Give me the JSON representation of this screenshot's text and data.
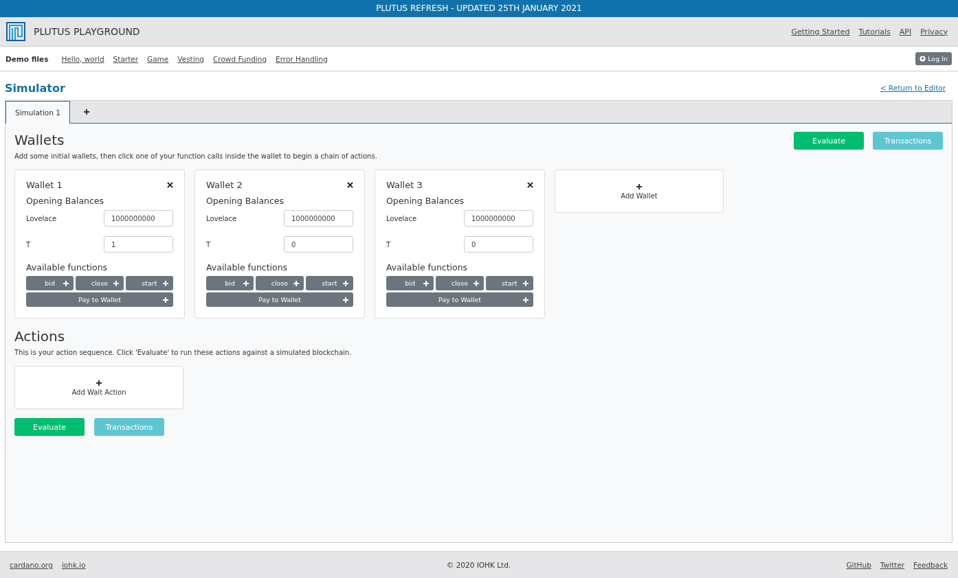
{
  "banner": "PLUTUS REFRESH - UPDATED 25TH JANUARY 2021",
  "header": {
    "title": "PLUTUS PLAYGROUND",
    "links": [
      "Getting Started",
      "Tutorials",
      "API",
      "Privacy"
    ]
  },
  "demo_bar": {
    "label": "Demo files",
    "files": [
      "Hello, world",
      "Starter",
      "Game",
      "Vesting",
      "Crowd Funding",
      "Error Handling"
    ],
    "login": "Log In"
  },
  "page": {
    "title": "Simulator",
    "return_link": "< Return to Editor"
  },
  "tabs": [
    {
      "label": "Simulation 1",
      "selected": true
    }
  ],
  "wallets_section": {
    "title": "Wallets",
    "description": "Add some initial wallets, then click one of your function calls inside the wallet to begin a chain of actions.",
    "evaluate": "Evaluate",
    "transactions": "Transactions"
  },
  "wallets": [
    {
      "title": "Wallet 1",
      "balances_title": "Opening Balances",
      "balances": [
        {
          "label": "Lovelace",
          "value": "1000000000"
        },
        {
          "label": "T",
          "value": "1"
        }
      ],
      "functions_title": "Available functions",
      "functions": [
        "bid",
        "close",
        "start",
        "Pay to Wallet"
      ]
    },
    {
      "title": "Wallet 2",
      "balances_title": "Opening Balances",
      "balances": [
        {
          "label": "Lovelace",
          "value": "1000000000"
        },
        {
          "label": "T",
          "value": "0"
        }
      ],
      "functions_title": "Available functions",
      "functions": [
        "bid",
        "close",
        "start",
        "Pay to Wallet"
      ]
    },
    {
      "title": "Wallet 3",
      "balances_title": "Opening Balances",
      "balances": [
        {
          "label": "Lovelace",
          "value": "1000000000"
        },
        {
          "label": "T",
          "value": "0"
        }
      ],
      "functions_title": "Available functions",
      "functions": [
        "bid",
        "close",
        "start",
        "Pay to Wallet"
      ]
    }
  ],
  "add_wallet": "Add Wallet",
  "actions_section": {
    "title": "Actions",
    "description": "This is your action sequence. Click 'Evaluate' to run these actions against a simulated blockchain.",
    "add_wait": "Add Wait Action",
    "evaluate": "Evaluate",
    "transactions": "Transactions"
  },
  "footer": {
    "left_links": [
      "cardano.org",
      "iohk.io"
    ],
    "copyright": "© 2020 IOHK Ltd.",
    "right_links": [
      "GitHub",
      "Twitter",
      "Feedback"
    ]
  }
}
